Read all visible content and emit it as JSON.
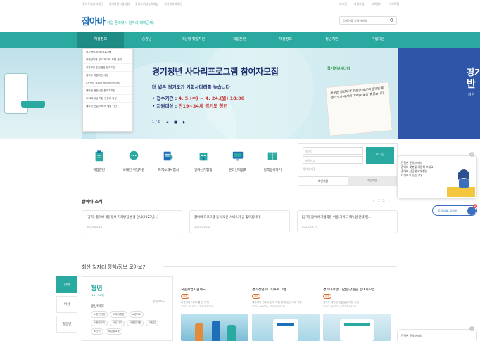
{
  "topbar": {
    "left": [
      "경기도일자리재단",
      "경기여성취업지원",
      "경기도여성능력개발",
      "경기일자리재단"
    ],
    "right": [
      "로그인",
      "회원가입",
      "고객센터",
      "사이트맵"
    ]
  },
  "header": {
    "logo": "잡아바",
    "slogan_prefix": "취업 준비에서 ",
    "slogan_accent": "일자리(예비군제)",
    "search_placeholder": "검색어를 입력하세요"
  },
  "nav": [
    "채용정보",
    "중장년",
    "재능형 취업지원",
    "직업훈련",
    "채용정보",
    "청년지원",
    "기업지원"
  ],
  "submenu": [
    "경기청년사다리프로그램",
    "마케팅특별 본도 재교육 포함 참여",
    "취업보장 현장실습 참여기업",
    "경기도 지원혁신 사업",
    "4차산업 부울환 재직자지원 사업",
    "대학생 현장실습 참여자모집",
    "SNS마케팅 기본 인증과 과정",
    "해외취 진입 서비스 체험 기관"
  ],
  "banner": {
    "title": "경기청년 사다리프로그램 참여자모집",
    "sub": "더 넓은 경기도가 기회사다리를 놓습니다",
    "date_label": "• 접수기간 :",
    "date_value": "4. 5.(수) ~ 4. 24.(월) 18:00",
    "target_label": "• 지원대상 :",
    "target_value": "만19~34세 경기도 청년",
    "pager": [
      "1 / 5",
      "◀",
      "■",
      "▶"
    ],
    "badge": "경기청년사다리",
    "note": "꿈꾸는 청년에게 무한한 세상이 열리도록, 경기도가 세계의 기회를 놓아 주겠습니다.",
    "right_line1": "경기",
    "right_line2": "반",
    "right_line3": "지원"
  },
  "quick": [
    {
      "label": "취업진단"
    },
    {
      "label": "비대면 취업지원"
    },
    {
      "label": "자기소개서첨삭"
    },
    {
      "label": "일하는기업캠"
    },
    {
      "label": "온라인박람회"
    },
    {
      "label": "정책등록하기"
    }
  ],
  "login": {
    "id_placeholder": "아이디",
    "pw_placeholder": "비밀번호",
    "button": "로그인",
    "keep": "아이디 저장",
    "tab_personal": "개인회원",
    "tab_company": "기업회원"
  },
  "news": {
    "heading": "잡아바 소식",
    "pager": "1 / 2",
    "items": [
      {
        "title": "[공지] 잡아바 개인정보 처리방침 변경 안내(2023년...)",
        "date": "2023-03-16"
      },
      {
        "title": "잡아바 프로그램 등 새로운 서비스가 곧 찾아옵니다.",
        "date": "2023-02-02"
      },
      {
        "title": "[공지] 잡아바 기업회원 이용 가이드 매뉴얼 안내 및...",
        "date": "2023-09-15"
      }
    ]
  },
  "policy": {
    "heading": "최신 일자리 정책/정보 모아보기",
    "tabs": [
      "청년",
      "여성",
      "중장년"
    ],
    "youth": {
      "title": "청년",
      "age": "(15~34세)",
      "more": "관계보기 →",
      "category": "관심키워드",
      "tags": [
        "#청년지원",
        "#해외취업",
        "#경기도",
        "#청년구직",
        "#일자리",
        "#면접지원",
        "#창업",
        "#인턴",
        "#금융교육"
      ]
    },
    "cards": [
      {
        "title": "국민취업지원제도",
        "badge": "모집",
        "sub": "취업지원 서비스를 한 번에",
        "date": "2023-01-01 ~ 2023-12-31"
      },
      {
        "title": "경기청년사다리프로그램",
        "badge": "모집",
        "sub": "해외대학 연수와 현지 체험 통해 청년 국제 역량",
        "date": "2023-04-05 ~ 2023-04-24"
      },
      {
        "title": "경기대학생 기업현장실습 참여자모집",
        "badge": "모집",
        "sub": "경기도 대학생 현장실습 지원 사업",
        "date": "2023-04-12 ~ 2023-04-26"
      }
    ]
  },
  "chatbot": {
    "lines": [
      "간단한 문의 서비스",
      "잡아바 챗봇을 이용해 보세요",
      "잡아바 상담센터가 항상",
      "대기하고 있습니다!"
    ],
    "button": "도움되요, 잡아바",
    "badge": "2",
    "second": "간단한 문의 서비스"
  }
}
